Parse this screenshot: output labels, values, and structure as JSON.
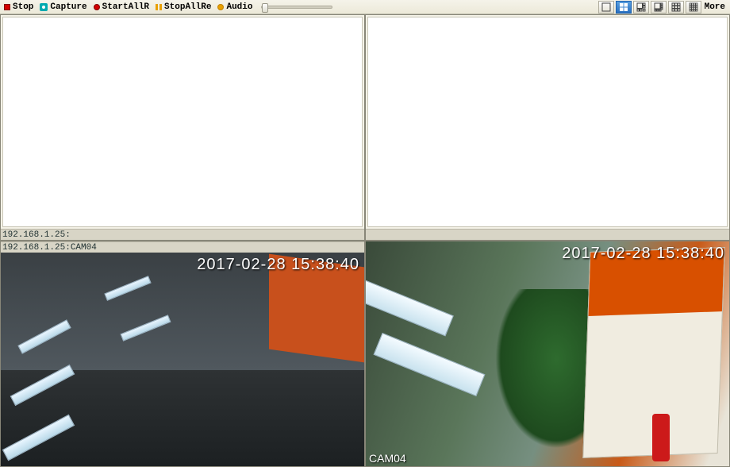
{
  "toolbar": {
    "stop": "Stop",
    "capture": "Capture",
    "start_all": "StartAllR",
    "stop_all": "StopAllRe",
    "audio": "Audio",
    "more": "More"
  },
  "layout_buttons": [
    "layout-1",
    "layout-4",
    "layout-6",
    "layout-8",
    "layout-9",
    "layout-16"
  ],
  "active_layout": "layout-4",
  "cells": [
    {
      "info": "192.168.1.25:",
      "has_feed": false,
      "timestamp": "",
      "cam_label": ""
    },
    {
      "info": "",
      "has_feed": false,
      "timestamp": "",
      "cam_label": ""
    },
    {
      "info": "192.168.1.25:CAM04",
      "has_feed": true,
      "timestamp": "2017-02-28 15:38:40",
      "cam_label": ""
    },
    {
      "info": "",
      "has_feed": true,
      "timestamp": "2017-02-28 15:38:40",
      "cam_label": "CAM04"
    }
  ],
  "colors": {
    "accent": "#2a70c0",
    "toolbar_bg": "#ece9d8"
  }
}
